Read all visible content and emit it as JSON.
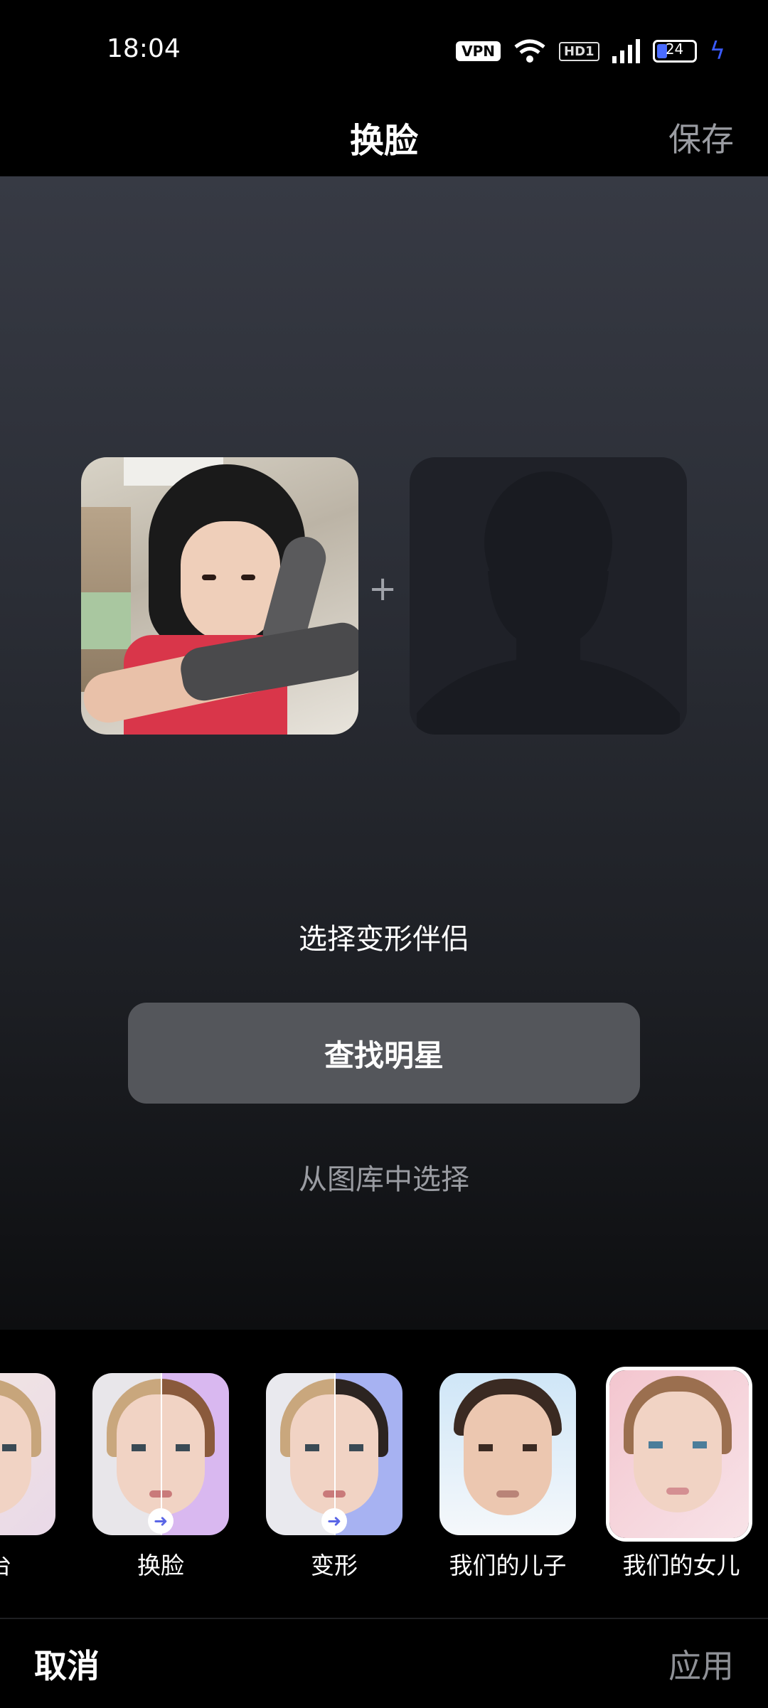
{
  "status_bar": {
    "time": "18:04",
    "vpn": "VPN",
    "hd": "HD1",
    "network": "4G",
    "battery": "24"
  },
  "header": {
    "title": "换脸",
    "save": "保存"
  },
  "main": {
    "plus": "+",
    "choose_partner": "选择变形伴侣",
    "find_star": "查找明星",
    "from_gallery": "从图库中选择"
  },
  "filters": [
    {
      "label": "台",
      "selected": false
    },
    {
      "label": "换脸",
      "selected": false
    },
    {
      "label": "变形",
      "selected": false
    },
    {
      "label": "我们的儿子",
      "selected": false
    },
    {
      "label": "我们的女儿",
      "selected": true
    }
  ],
  "footer": {
    "cancel": "取消",
    "apply": "应用"
  },
  "colors": {
    "accent_bolt": "#3a5bff",
    "button_bg": "#54565b"
  }
}
